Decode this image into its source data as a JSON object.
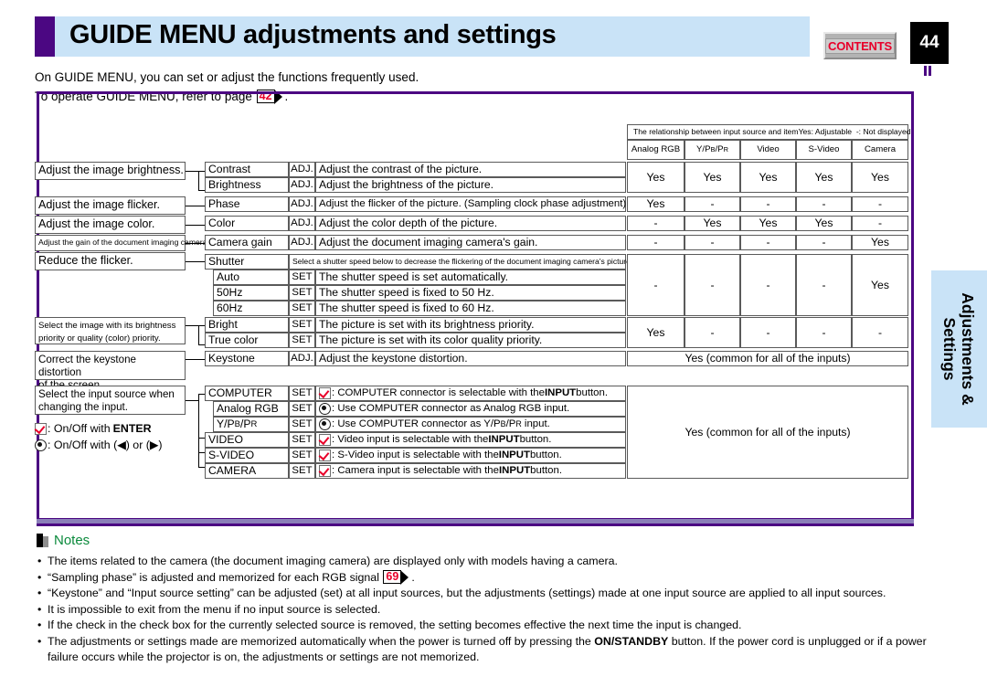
{
  "header": {
    "title": "GUIDE MENU adjustments and settings",
    "contents_label": "CONTENTS",
    "page_number": "44"
  },
  "side_tab": {
    "label": "Adjustments & Settings"
  },
  "intro": {
    "line1": "On GUIDE MENU, you can set or adjust the functions frequently used.",
    "line2_pre": "To operate GUIDE MENU, refer to page",
    "line2_ref": "42",
    "line2_post": "."
  },
  "matrix": {
    "caption": "The relationship between input source and item",
    "legend_yes": "Yes: Adjustable",
    "legend_no": "-: Not displayed",
    "columns": [
      "Analog RGB",
      "Y/PB/PR",
      "Video",
      "S-Video",
      "Camera"
    ],
    "col_y": "Y/P",
    "col_y_b": "B",
    "col_y_mid": "/P",
    "col_y_r": "R"
  },
  "left_labels": [
    {
      "text": "Adjust the image brightness."
    },
    {
      "text": "Adjust the image flicker."
    },
    {
      "text": "Adjust the image color."
    },
    {
      "text": "Adjust the gain of the document imaging camera."
    },
    {
      "text": "Reduce the flicker."
    },
    {
      "line1": "Select the image with its brightness",
      "line2": "priority or quality (color) priority."
    },
    {
      "line1": "Correct the keystone distortion",
      "line2": "of the screen."
    },
    {
      "line1": "Select the input source when",
      "line2": "changing the input."
    }
  ],
  "legend": {
    "check_text": ": On/Off with ",
    "check_bold": "ENTER",
    "radio_text": ": On/Off with (◀) or (▶)"
  },
  "rows": {
    "contrast": {
      "name": "Contrast",
      "type": "ADJ.",
      "desc": "Adjust the contrast of the picture.",
      "vals": [
        "Yes",
        "Yes",
        "Yes",
        "Yes",
        "Yes"
      ]
    },
    "brightness": {
      "name": "Brightness",
      "type": "ADJ.",
      "desc": "Adjust the brightness of the picture.",
      "vals": []
    },
    "phase": {
      "name": "Phase",
      "type": "ADJ.",
      "desc": "Adjust the flicker of the picture. (Sampling clock phase adjustment)",
      "vals": [
        "Yes",
        "-",
        "-",
        "-",
        "-"
      ]
    },
    "color": {
      "name": "Color",
      "type": "ADJ.",
      "desc": "Adjust the color depth of the picture.",
      "vals": [
        "-",
        "Yes",
        "Yes",
        "Yes",
        "-"
      ]
    },
    "camera_gain": {
      "name": "Camera gain",
      "type": "ADJ.",
      "desc": "Adjust the document imaging camera's gain.",
      "vals": [
        "-",
        "-",
        "-",
        "-",
        "Yes"
      ]
    },
    "shutter": {
      "name": "Shutter",
      "type": "",
      "desc": "Select a shutter speed below to decrease the flickering of the document imaging camera's picture.",
      "vals": [
        "-",
        "-",
        "-",
        "-",
        "Yes"
      ]
    },
    "auto": {
      "name": "Auto",
      "type": "SET",
      "desc": "The shutter speed is set automatically."
    },
    "hz50": {
      "name": "50Hz",
      "type": "SET",
      "desc": "The shutter speed is fixed to 50 Hz."
    },
    "hz60": {
      "name": "60Hz",
      "type": "SET",
      "desc": "The shutter speed is fixed to 60 Hz."
    },
    "bright": {
      "name": "Bright",
      "type": "SET",
      "desc": "The picture is set with its brightness priority.",
      "vals": [
        "Yes",
        "-",
        "-",
        "-",
        "-"
      ]
    },
    "true_color": {
      "name": "True color",
      "type": "SET",
      "desc": "The picture is set with its color quality priority."
    },
    "keystone": {
      "name": "Keystone",
      "type": "ADJ.",
      "desc": "Adjust the keystone distortion.",
      "common": "Yes (common for all of the inputs)"
    },
    "computer": {
      "name": "COMPUTER",
      "type": "SET",
      "desc_pre": ": COMPUTER connector is selectable with the ",
      "desc_bold": "INPUT",
      "desc_post": " button.",
      "icon": "check"
    },
    "analog_rgb": {
      "name": "Analog RGB",
      "type": "SET",
      "desc_pre": ": Use COMPUTER connector as Analog RGB input.",
      "icon": "radio"
    },
    "ypbpr": {
      "name": "Y/PB/PR",
      "type": "SET",
      "desc_pre": ": Use COMPUTER connector as Y/PB/PR input.",
      "icon": "radio"
    },
    "video": {
      "name": "VIDEO",
      "type": "SET",
      "desc_pre": ": Video input is selectable with the ",
      "desc_bold": "INPUT",
      "desc_post": " button.",
      "icon": "check"
    },
    "svideo": {
      "name": "S-VIDEO",
      "type": "SET",
      "desc_pre": ": S-Video input is selectable with the ",
      "desc_bold": "INPUT",
      "desc_post": " button.",
      "icon": "check"
    },
    "camera": {
      "name": "CAMERA",
      "type": "SET",
      "desc_pre": ": Camera input is selectable with the ",
      "desc_bold": "INPUT",
      "desc_post": " button.",
      "icon": "check"
    },
    "inputs_common": "Yes (common for all of the inputs)"
  },
  "notes": {
    "title": "Notes",
    "items": [
      {
        "text": "The items related to the camera (the document imaging camera) are displayed only with models having a camera."
      },
      {
        "pre": "“Sampling phase” is adjusted and memorized for each RGB signal",
        "ref": "69",
        "post": "."
      },
      {
        "text": "“Keystone” and “Input source setting” can be adjusted (set) at all input sources, but the adjustments (settings) made at one input source are applied to all input sources."
      },
      {
        "text": "It is impossible to exit from the menu if no input source is selected."
      },
      {
        "text": "If the check in the check box for the currently selected source is removed, the setting becomes effective the next time the input is changed."
      },
      {
        "pre": "The adjustments or settings made are memorized automatically when the power is turned off by pressing the",
        "bold": "ON/STANDBY",
        "post": "button. If the power cord is unplugged or if a power failure occurs while the projector is on, the adjustments or settings are not memorized."
      }
    ]
  }
}
